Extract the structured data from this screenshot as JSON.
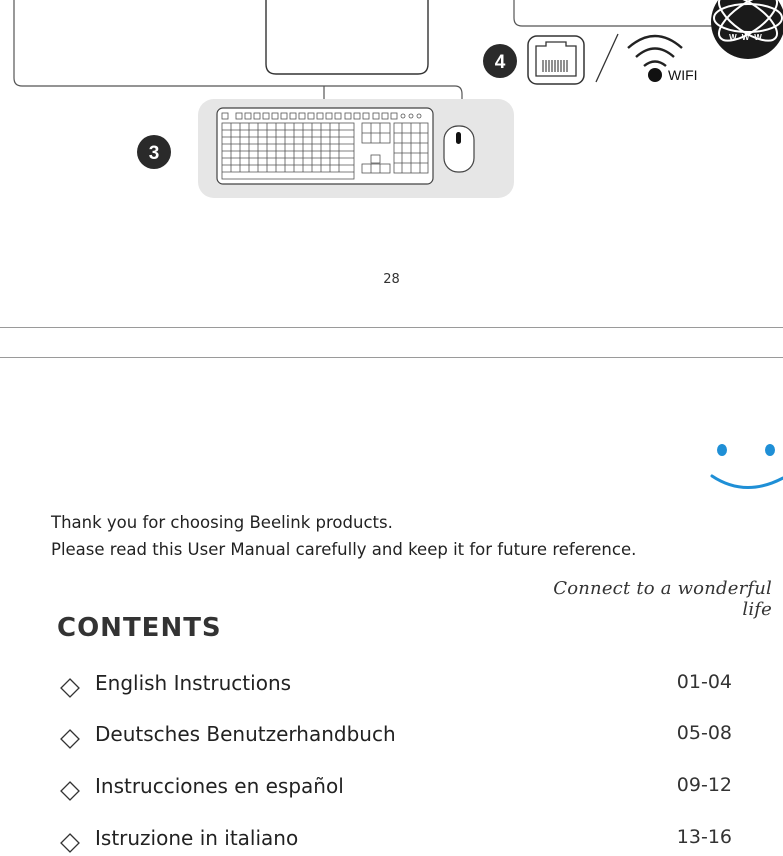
{
  "diagram": {
    "badge_keyboard": "3",
    "badge_network": "4",
    "wifi_label": "WIFI",
    "globe_label": "WWW"
  },
  "page_number": "28",
  "intro": {
    "line1": "Thank you for choosing Beelink products.",
    "line2": "Please read this User Manual carefully and keep it for future reference."
  },
  "tagline": "Connect to a wonderful life",
  "contents": {
    "title": "CONTENTS",
    "items": [
      {
        "label": "English Instructions",
        "pages": "01-04"
      },
      {
        "label": "Deutsches Benutzerhandbuch",
        "pages": "05-08"
      },
      {
        "label": "Instrucciones en español",
        "pages": "09-12"
      },
      {
        "label": "Istruzione in italiano",
        "pages": "13-16"
      }
    ]
  },
  "colors": {
    "accent_blue": "#1f8fd6",
    "line_gray": "#9a9a9a",
    "panel_gray": "#e6e6e6"
  }
}
